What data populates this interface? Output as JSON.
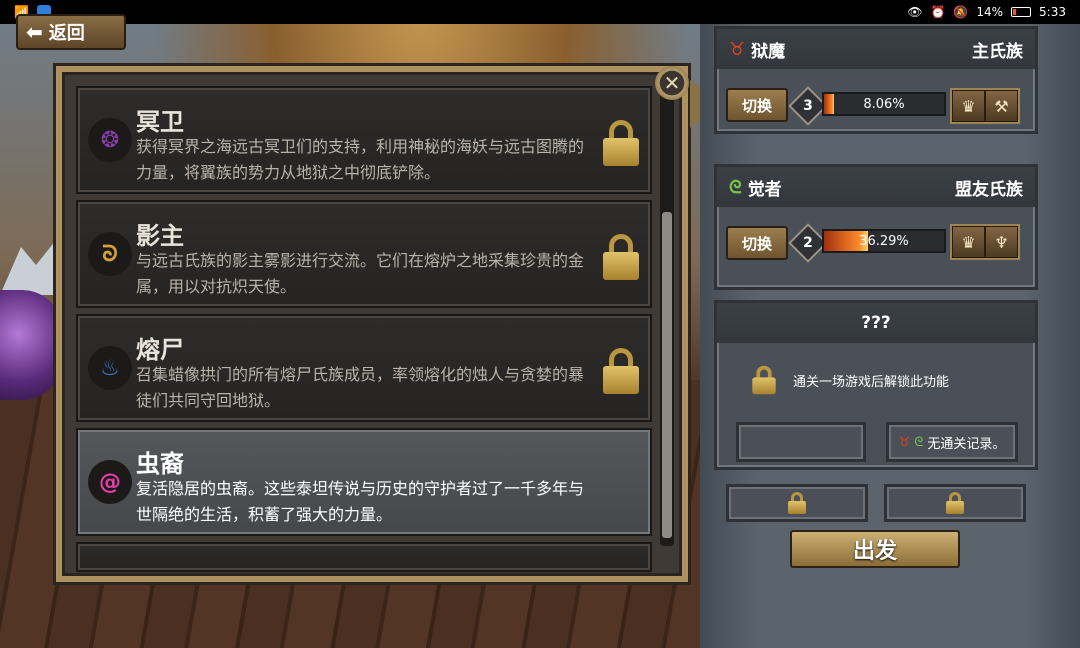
{
  "status_bar": {
    "battery": "14%",
    "time": "5:33"
  },
  "back_button": {
    "label": "返回"
  },
  "clans": [
    {
      "name": "冥卫",
      "desc": "获得冥界之海远古冥卫们的支持，利用神秘的海妖与远古图腾的力量，将翼族的势力从地狱之中彻底铲除。",
      "emblem_color": "#8c3fb0",
      "locked": true,
      "selected": false
    },
    {
      "name": "影主",
      "desc": "与远古氏族的影主雾影进行交流。它们在熔炉之地采集珍贵的金属，用以对抗炽天使。",
      "emblem_color": "#d6a13a",
      "locked": true,
      "selected": false
    },
    {
      "name": "熔尸",
      "desc": "召集蜡像拱门的所有熔尸氏族成员，率领熔化的烛人与贪婪的暴徒们共同守回地狱。",
      "emblem_color": "#3f7fd6",
      "locked": true,
      "selected": false
    },
    {
      "name": "虫裔",
      "desc": "复活隐居的虫裔。这些泰坦传说与历史的守护者过了一千多年与世隔绝的生活，积蓄了强大的力量。",
      "emblem_color": "#e23fa8",
      "locked": false,
      "selected": true
    }
  ],
  "side": {
    "primary": {
      "role": "狱魔",
      "clan_type": "主氏族",
      "role_icon_color": "#e0431f",
      "switch_label": "切换",
      "level": "3",
      "progress_text": "8.06%",
      "progress": 0.0806
    },
    "ally": {
      "role": "觉者",
      "clan_type": "盟友氏族",
      "role_icon_color": "#7ac24a",
      "switch_label": "切换",
      "level": "2",
      "progress_text": "36.29%",
      "progress": 0.3629
    },
    "unknown": {
      "title": "???",
      "unlock_text": "通关一场游戏后解锁此功能",
      "record_text": "无通关记录。"
    },
    "go_label": "出发"
  }
}
